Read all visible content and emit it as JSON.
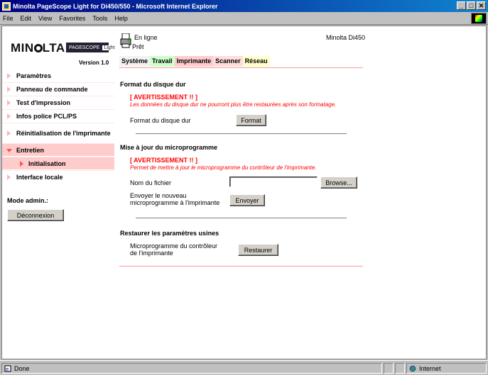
{
  "window": {
    "title": "Minolta PageScope Light for Di450/550 - Microsoft Internet Explorer",
    "minimize": "_",
    "maximize": "□",
    "close": "✕"
  },
  "menu": {
    "file": "File",
    "edit": "Edit",
    "view": "View",
    "favorites": "Favorites",
    "tools": "Tools",
    "help": "Help"
  },
  "header": {
    "logo_text": "MIN",
    "logo_text_end": "LTA",
    "pagescope": "PAGESCOPE",
    "light": "Light",
    "version": "Version 1.0",
    "status_online": "En ligne",
    "status_ready": "Prêt",
    "model": "Minolta Di450"
  },
  "tabs": [
    {
      "label": "Système"
    },
    {
      "label": "Travail"
    },
    {
      "label": "Imprimante"
    },
    {
      "label": "Scanner"
    },
    {
      "label": "Réseau"
    }
  ],
  "sidebar": {
    "items": [
      {
        "label": "Paramètres"
      },
      {
        "label": "Panneau de commande"
      },
      {
        "label": "Test d'impression"
      },
      {
        "label": "Infos police PCL/PS"
      },
      {
        "label": "Réinitialisation de l'imprimante"
      },
      {
        "label": "Entretien"
      },
      {
        "label": "Initialisation"
      },
      {
        "label": "Interface locale"
      }
    ],
    "admin_label": "Mode admin.:",
    "logout_button": "Déconnexion"
  },
  "main": {
    "disk_format": {
      "heading": "Format du disque dur",
      "warning_title": "[ AVERTISSEMENT !! ]",
      "warning_text": "Les données du disque dur ne pourront plus être restaurées après son formatage.",
      "label": "Format du disque dur",
      "button": "Format"
    },
    "firmware": {
      "heading": "Mise à jour du microprogramme",
      "warning_title": "[ AVERTISSEMENT !! ]",
      "warning_text": "Permet de mettre à jour le microprogramme du contrôleur de l'imprimante.",
      "file_label": "Nom du fichier",
      "file_value": "",
      "browse_button": "Browse...",
      "send_label": "Envoyer le nouveau microprogramme à l'imprimante",
      "send_button": "Envoyer"
    },
    "factory": {
      "heading": "Restaurer les paramètres usines",
      "label": "Microprogramme du contrôleur de l'imprimante",
      "button": "Restaurer"
    }
  },
  "statusbar": {
    "left": "Done",
    "zone": "Internet"
  },
  "colors": {
    "titlebar": "#000080",
    "accent_pink": "#ffcccc",
    "warning_red": "#ff0000"
  }
}
